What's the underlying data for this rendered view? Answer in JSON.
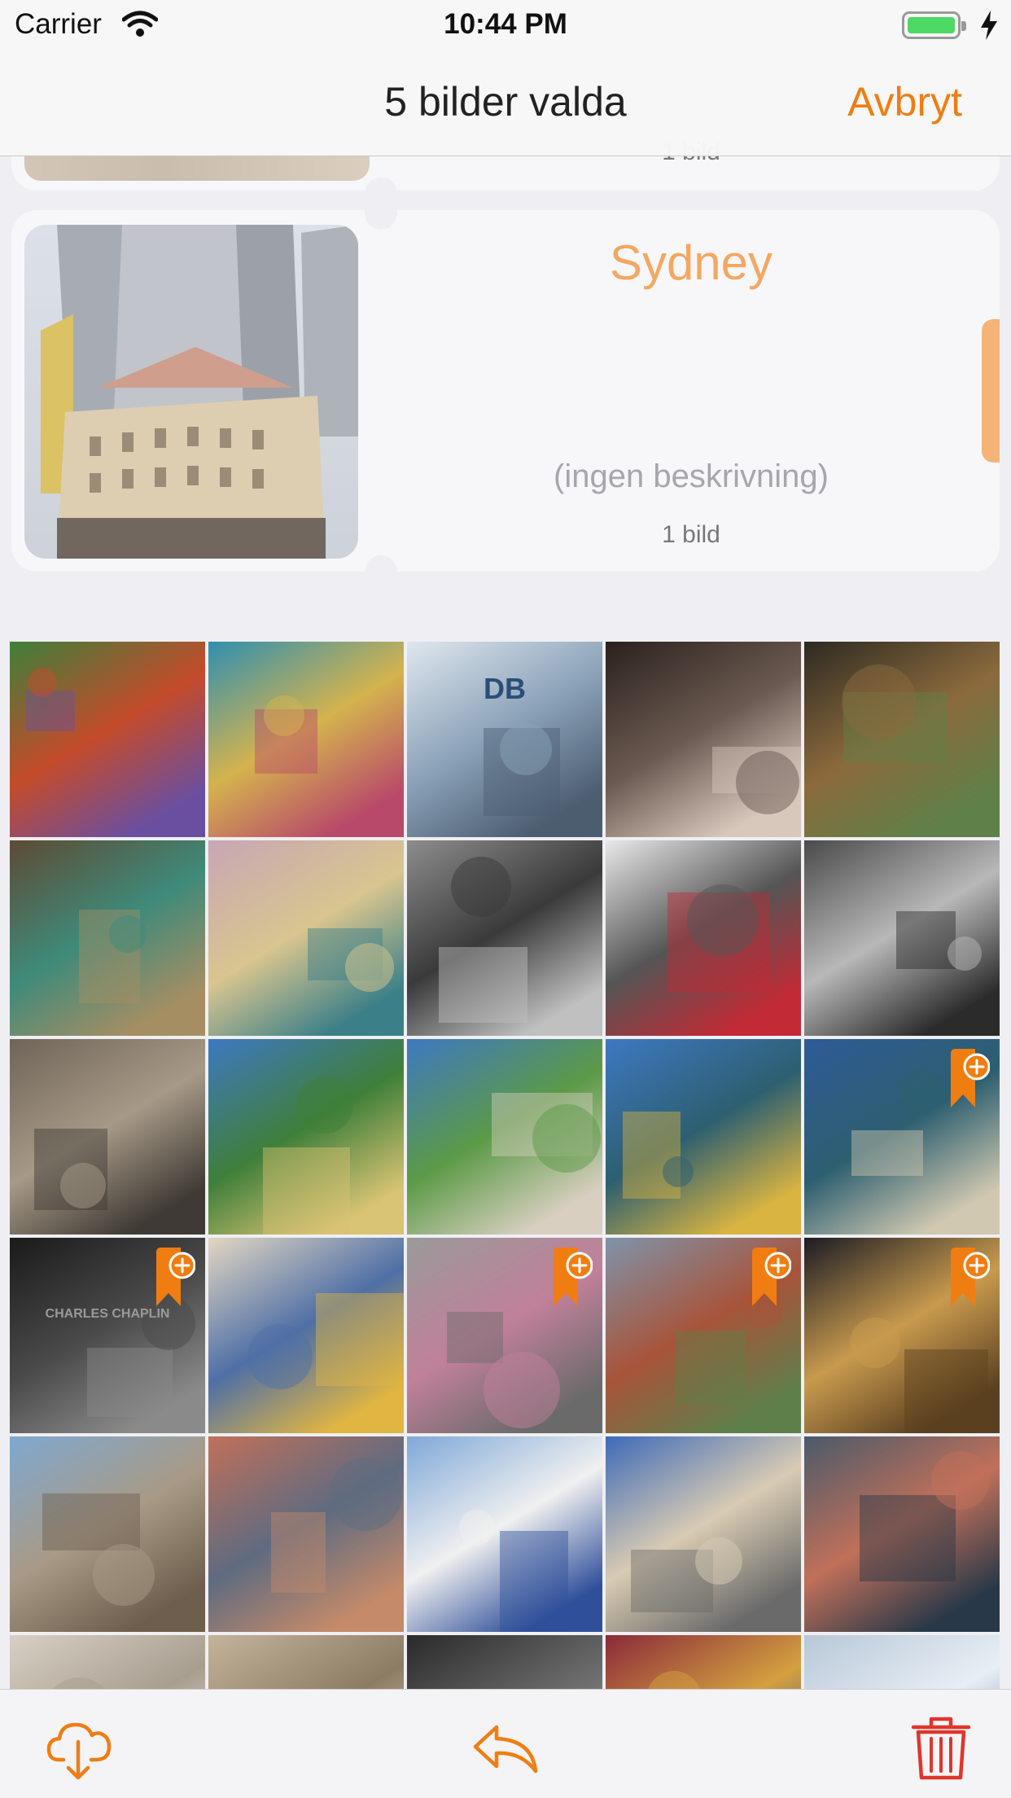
{
  "status_bar": {
    "carrier": "Carrier",
    "time": "10:44 PM"
  },
  "nav": {
    "title": "5 bilder valda",
    "cancel_label": "Avbryt"
  },
  "albums": [
    {
      "title": "",
      "description": "",
      "count": "1 bild"
    },
    {
      "title": "Sydney",
      "description": "(ingen beskrivning)",
      "count": "1 bild"
    }
  ],
  "album_photo_text": "Sydney",
  "photo_tiles": [
    {
      "desc": "graffiti dragon wall",
      "colors": [
        "#3f7f3a",
        "#c44b2b",
        "#6a4fa0"
      ]
    },
    {
      "desc": "colorful mural wall",
      "colors": [
        "#2f8fb0",
        "#d4b34e",
        "#b8496a"
      ]
    },
    {
      "desc": "Berlin Hauptbahnhof DB sign",
      "text": "DB",
      "colors": [
        "#dfe7ee",
        "#8aa1b8",
        "#4c5d70"
      ]
    },
    {
      "desc": "dark railing ornaments",
      "colors": [
        "#2a211d",
        "#6b5a51",
        "#d8c8bc"
      ]
    },
    {
      "desc": "window grid with pottery",
      "colors": [
        "#2d2a22",
        "#8b6a3d",
        "#5f8048"
      ]
    },
    {
      "desc": "abandoned room",
      "colors": [
        "#5d4b34",
        "#3f8a7a",
        "#a68e63"
      ]
    },
    {
      "desc": "river dam at dusk",
      "colors": [
        "#c8a6b5",
        "#d8c58f",
        "#3b7f88"
      ]
    },
    {
      "desc": "window in ruined wall bw",
      "colors": [
        "#8d8d8d",
        "#3a3a3a",
        "#c0c0c0"
      ]
    },
    {
      "desc": "portrait sketch red door",
      "colors": [
        "#e8e8e8",
        "#555555",
        "#c22a35"
      ]
    },
    {
      "desc": "classical building bw",
      "colors": [
        "#4a4a4a",
        "#b8b8b8",
        "#2b2b2b"
      ]
    },
    {
      "desc": "stone castle gate",
      "colors": [
        "#6f6458",
        "#a69986",
        "#3f3a35"
      ]
    },
    {
      "desc": "palace fountains",
      "colors": [
        "#3e78c2",
        "#3f7f3a",
        "#d9c374"
      ]
    },
    {
      "desc": "palace garden fountain",
      "colors": [
        "#3e78c2",
        "#5c9a47",
        "#d8cfc0"
      ]
    },
    {
      "desc": "golden fountain statue",
      "colors": [
        "#3e78c2",
        "#2d5f70",
        "#d9b441"
      ]
    },
    {
      "desc": "fountain pond",
      "colors": [
        "#2f5a96",
        "#2d5f70",
        "#d0c8b0"
      ],
      "selected": true
    },
    {
      "desc": "Charles Chaplin star",
      "text": "CHARLES CHAPLIN",
      "colors": [
        "#1a1a1a",
        "#4a4a4a",
        "#8a8a8a"
      ],
      "selected": true
    },
    {
      "desc": "half-timbered houses",
      "colors": [
        "#e2d7c2",
        "#4f6fa6",
        "#e0b542"
      ]
    },
    {
      "desc": "pink bird graffiti",
      "colors": [
        "#9a9a9a",
        "#c0809a",
        "#6a6a6a"
      ],
      "selected": true
    },
    {
      "desc": "town with red roofs",
      "colors": [
        "#7f93aa",
        "#a8543a",
        "#5f7f4a"
      ],
      "selected": true
    },
    {
      "desc": "plaza at night",
      "colors": [
        "#1b1c24",
        "#c89a4e",
        "#5a4020"
      ],
      "selected": true
    },
    {
      "desc": "stone rooftops",
      "colors": [
        "#7fa8d0",
        "#a89a86",
        "#6d5e4d"
      ]
    },
    {
      "desc": "tower bridge reflection",
      "colors": [
        "#c0705a",
        "#5f6b80",
        "#c48a6a"
      ]
    },
    {
      "desc": "church blue domes",
      "colors": [
        "#7fa8d8",
        "#f0f0f0",
        "#2f4f9a"
      ]
    },
    {
      "desc": "ornate corner building",
      "colors": [
        "#3e6ab8",
        "#d8cbb3",
        "#6a6a6a"
      ]
    },
    {
      "desc": "harbor promenade sunset",
      "colors": [
        "#4a5a6a",
        "#c0705a",
        "#283848"
      ]
    },
    {
      "desc": "modern interior curves",
      "colors": [
        "#d8d0c4",
        "#a89e90",
        "#eae4da"
      ]
    },
    {
      "desc": "sandstone passage",
      "colors": [
        "#c4b49c",
        "#8c7c64",
        "#e0d4c0"
      ]
    },
    {
      "desc": "motion blur dark",
      "colors": [
        "#2a2a2a",
        "#6a6a6a",
        "#9a9a9a"
      ]
    },
    {
      "desc": "market stalls",
      "colors": [
        "#8a2a3a",
        "#d4a040",
        "#3a4a8a"
      ]
    },
    {
      "desc": "glass roof building",
      "colors": [
        "#b8c8d8",
        "#e8eef4",
        "#6a8aa8"
      ]
    }
  ],
  "toolbar": {
    "download_icon": "cloud-download-icon",
    "reply_icon": "reply-arrow-icon",
    "trash_icon": "trash-icon"
  },
  "colors": {
    "accent": "#f07d12",
    "accent_light": "#f5a761",
    "trash": "#e0352b"
  }
}
